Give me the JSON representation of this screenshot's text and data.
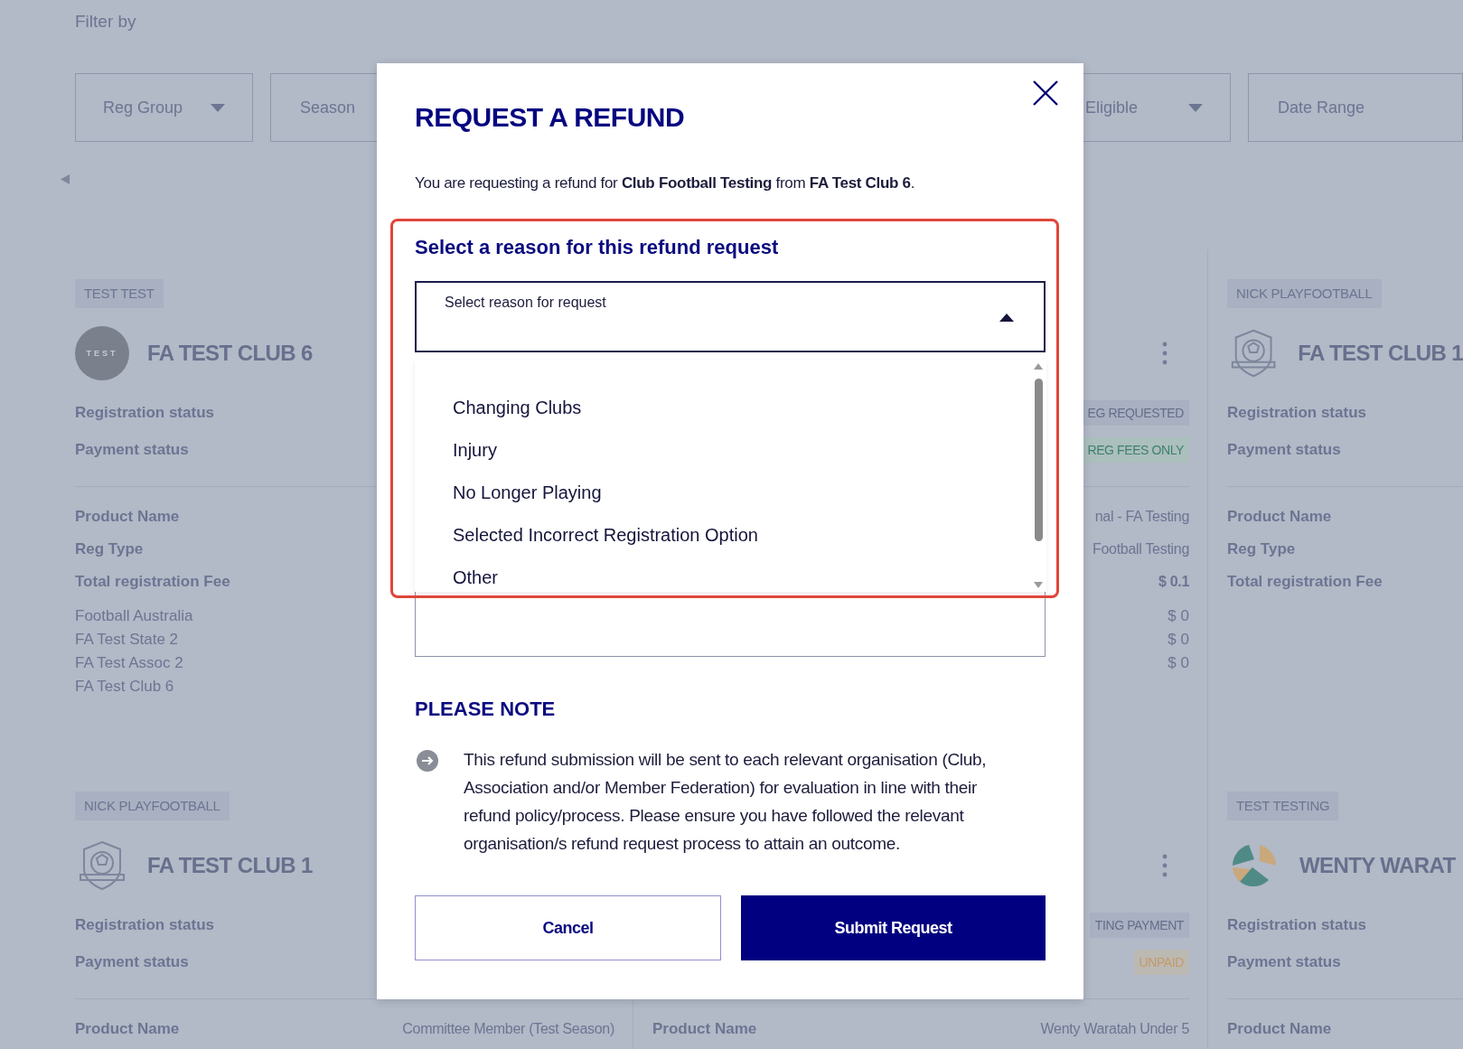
{
  "filter": {
    "title": "Filter by",
    "dropdowns": [
      {
        "label": "Reg Group",
        "kind": "dropdown"
      },
      {
        "label": "Season",
        "kind": "plain"
      },
      {
        "label": "Eligible",
        "kind": "dropdown"
      },
      {
        "label": "Date Range",
        "kind": "plain"
      }
    ]
  },
  "cards": [
    {
      "tag": "TEST TEST",
      "logo": {
        "kind": "initials",
        "text": "TEST"
      },
      "name": "FA TEST CLUB 6",
      "menu": false,
      "status": [
        {
          "label": "Registration status"
        },
        {
          "label": "Payment status"
        }
      ],
      "details": [
        {
          "label": "Product Name"
        },
        {
          "label": "Reg Type"
        },
        {
          "label": "Total registration Fee"
        }
      ],
      "fees": [
        {
          "label": "Football Australia"
        },
        {
          "label": "FA Test State 2"
        },
        {
          "label": "FA Test Assoc 2"
        },
        {
          "label": "FA Test Club 6"
        }
      ]
    },
    {
      "menu": true,
      "status": [
        {
          "badge": "EG REQUESTED",
          "kind": "neutral"
        },
        {
          "badge": "REG FEES ONLY",
          "kind": "green"
        }
      ],
      "details": [
        {
          "value": "nal - FA Testing"
        },
        {
          "value": "Football Testing"
        },
        {
          "value": "$ 0.1",
          "kind": "total"
        }
      ],
      "fees": [
        {
          "value": "$ 0"
        },
        {
          "value": "$ 0"
        },
        {
          "value": "$ 0"
        }
      ]
    },
    {
      "tag": "NICK PLAYFOOTBALL",
      "logo": {
        "kind": "shield"
      },
      "name": "FA TEST CLUB 1",
      "menu": false,
      "status": [
        {
          "label": "Registration status"
        },
        {
          "label": "Payment status"
        }
      ],
      "details": [
        {
          "label": "Product Name"
        },
        {
          "label": "Reg Type"
        },
        {
          "label": "Total registration Fee"
        }
      ]
    },
    {
      "tag": "NICK PLAYFOOTBALL",
      "logo": {
        "kind": "shield"
      },
      "name": "FA TEST CLUB 1",
      "menu": false,
      "status": [
        {
          "label": "Registration status"
        },
        {
          "label": "Payment status"
        }
      ],
      "details": [
        {
          "label": "Product Name",
          "value": "Committee Member (Test Season)"
        }
      ]
    },
    {
      "menu": true,
      "status": [
        {
          "badge": "TING PAYMENT",
          "kind": "neutral"
        },
        {
          "badge": "UNPAID",
          "kind": "unpaid"
        }
      ],
      "details": [
        {
          "label": "Product Name",
          "value": "Wenty Waratah Under 5"
        }
      ]
    },
    {
      "tag": "TEST TESTING",
      "logo": {
        "kind": "ball"
      },
      "name": "WENTY WARAT",
      "menu": false,
      "status": [
        {
          "label": "Registration status"
        },
        {
          "label": "Payment status"
        }
      ],
      "details": [
        {
          "label": "Product Name"
        }
      ]
    }
  ],
  "modal": {
    "title": "REQUEST A REFUND",
    "intro": "You are requesting a refund for **Club Football Testing** from **FA Test Club 6**.",
    "reason": {
      "heading": "Select a reason for this refund request",
      "highlighted": true,
      "placeholder": "Select reason for request",
      "expanded": true,
      "options": [
        {
          "label": "Changing Clubs",
          "selected": false
        },
        {
          "label": "Injury",
          "selected": false
        },
        {
          "label": "No Longer Playing",
          "selected": false
        },
        {
          "label": "Selected Incorrect Registration Option",
          "selected": false
        },
        {
          "label": "Other",
          "selected": false
        }
      ]
    },
    "note": {
      "heading": "PLEASE NOTE",
      "text": "This refund submission will be sent to each relevant organisation (Club, Association and/or Member Federation) for evaluation in line with their refund policy/process. Please ensure you have followed the relevant organisation/s refund request process to attain an outcome."
    },
    "buttons": [
      {
        "label": "Cancel",
        "kind": "secondary"
      },
      {
        "label": "Submit Request",
        "kind": "primary"
      }
    ]
  }
}
